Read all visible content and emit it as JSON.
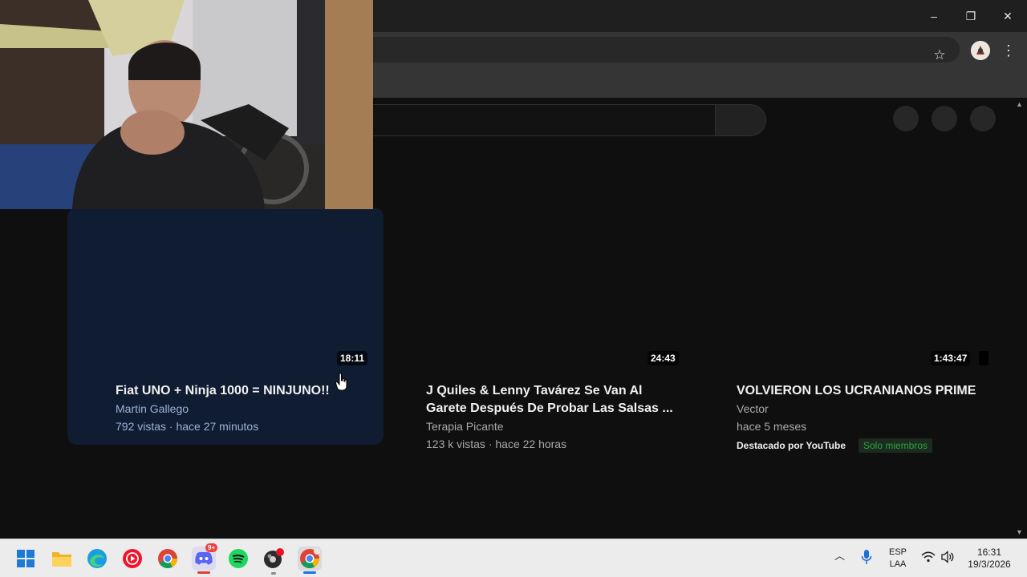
{
  "browser": {
    "window_controls": {
      "minimize": "–",
      "restore": "❐",
      "close": "✕"
    }
  },
  "videos": [
    {
      "title": "Fiat UNO + Ninja 1000 = NINJUNO!!",
      "channel": "Martin Gallego",
      "stats": "792 vistas · hace 27 minutos",
      "duration": "18:11"
    },
    {
      "title_line1": "J Quiles & Lenny Tavárez Se Van Al",
      "title_line2": "Garete Después De Probar Las Salsas ...",
      "channel": "Terapia Picante",
      "stats": "123 k vistas · hace 22 horas",
      "duration": "24:43"
    },
    {
      "title": "VOLVIERON LOS UCRANIANOS PRIME",
      "channel": "Vector",
      "stats": "hace 5 meses",
      "duration": "1:43:47",
      "featured": "Destacado por YouTube",
      "badge": "Solo miembros"
    }
  ],
  "taskbar": {
    "language": "ESP",
    "layout": "LAA",
    "time": "16:31",
    "date": "19/3/2026",
    "discord_badge": "9+"
  },
  "colors": {
    "accent_members": "#2ba640",
    "highlight_card": "#0f1c31"
  }
}
